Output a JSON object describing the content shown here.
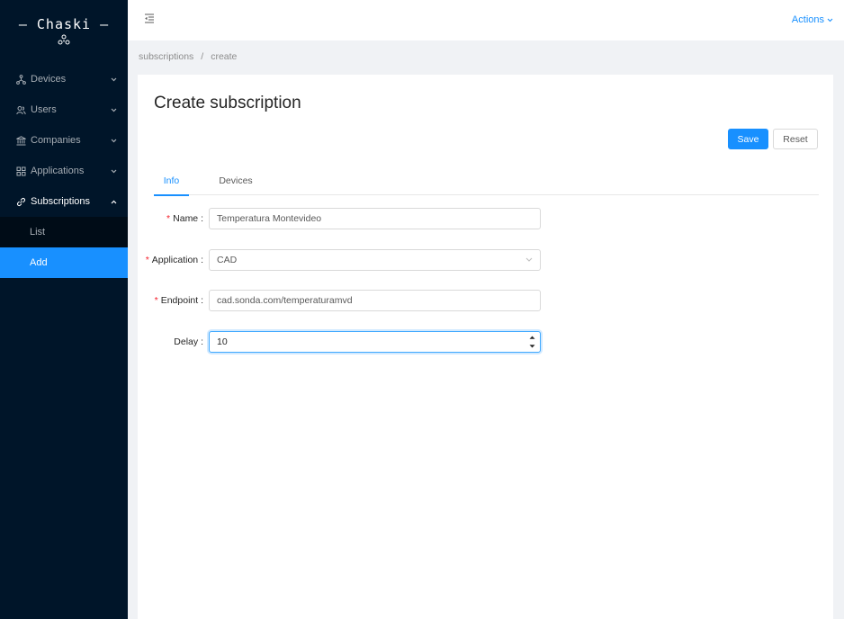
{
  "sidebar": {
    "logo_text": "— Chaski —",
    "items": [
      {
        "label": "Devices",
        "icon": "cluster-icon",
        "arrow": "down"
      },
      {
        "label": "Users",
        "icon": "users-icon",
        "arrow": "down"
      },
      {
        "label": "Companies",
        "icon": "bank-icon",
        "arrow": "down"
      },
      {
        "label": "Applications",
        "icon": "appstore-icon",
        "arrow": "down"
      },
      {
        "label": "Subscriptions",
        "icon": "link-icon",
        "arrow": "up"
      }
    ],
    "subscriptions_sub": [
      {
        "label": "List",
        "active": false
      },
      {
        "label": "Add",
        "active": true
      }
    ]
  },
  "header": {
    "actions_label": "Actions"
  },
  "breadcrumb": {
    "items": [
      "subscriptions",
      "create"
    ],
    "separator": "/"
  },
  "page": {
    "title": "Create subscription",
    "save_label": "Save",
    "reset_label": "Reset",
    "tabs": [
      {
        "label": "Info",
        "active": true
      },
      {
        "label": "Devices",
        "active": false
      }
    ]
  },
  "form": {
    "name": {
      "label": "Name",
      "required": true,
      "value": "Temperatura Montevideo"
    },
    "application": {
      "label": "Application",
      "required": true,
      "value": "CAD"
    },
    "endpoint": {
      "label": "Endpoint",
      "required": true,
      "value": "cad.sonda.com/temperaturamvd"
    },
    "delay": {
      "label": "Delay",
      "required": false,
      "value": "10"
    }
  },
  "colors": {
    "sidebar_bg": "#001529",
    "primary": "#1890ff",
    "required": "#f5222d"
  }
}
